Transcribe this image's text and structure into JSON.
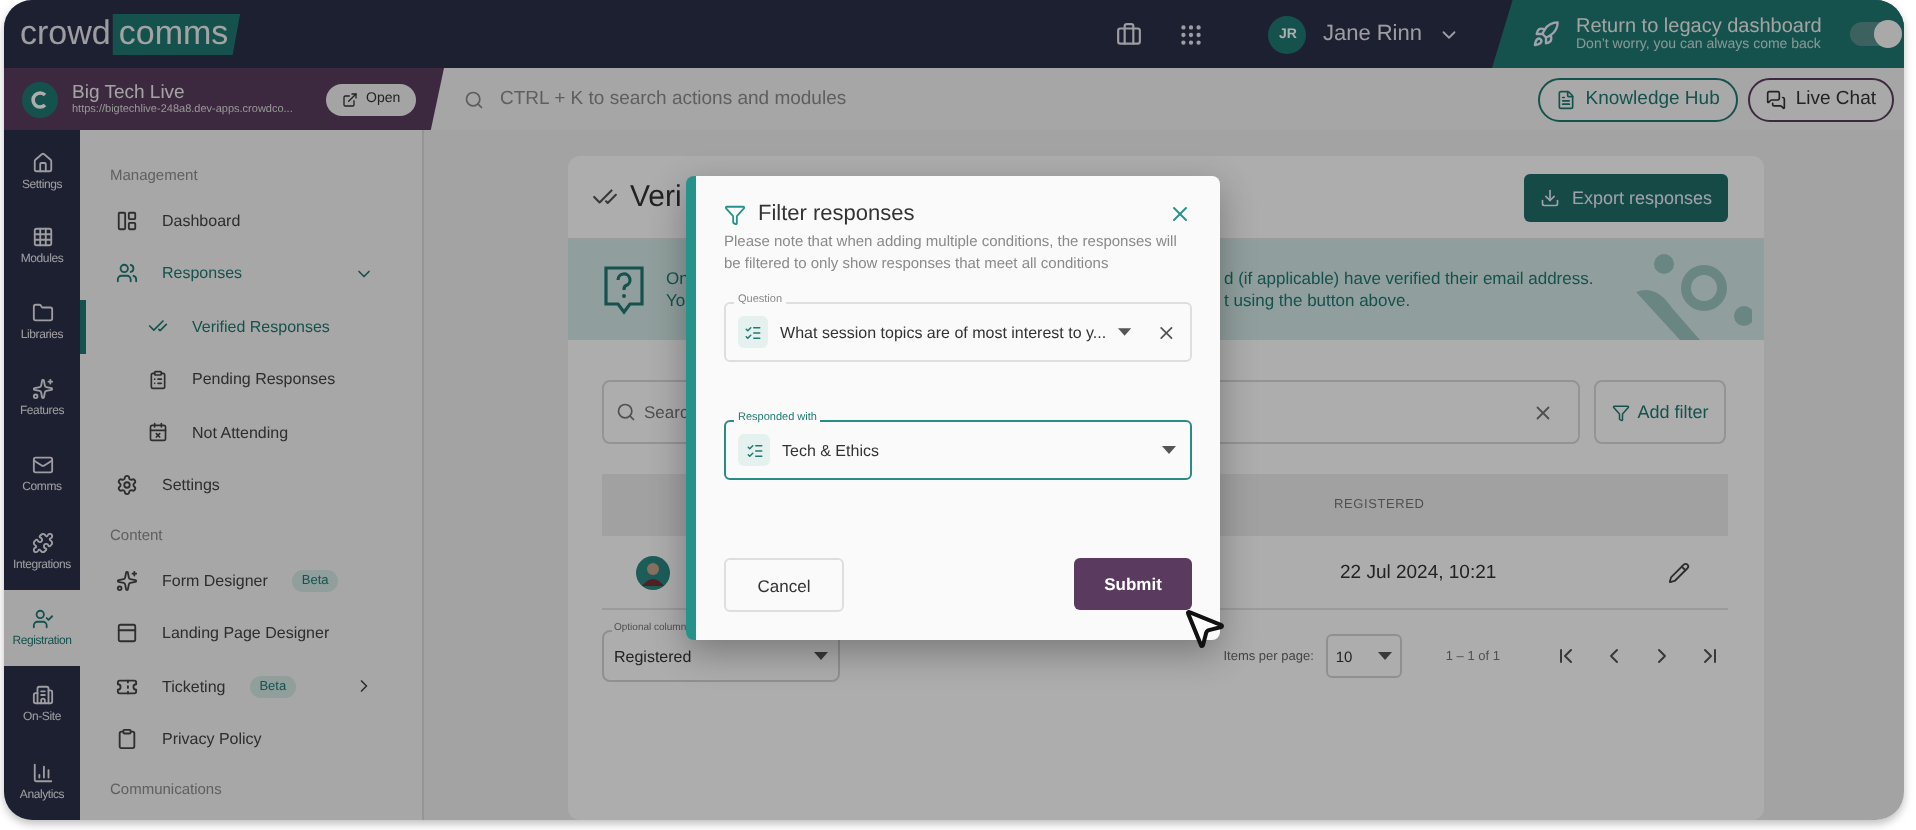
{
  "top_bar": {
    "logo": {
      "part_1": "crowd",
      "part_2": "comms"
    },
    "user": {
      "initials": "JR",
      "name": "Jane Rinn"
    },
    "legacy": {
      "title": "Return to legacy dashboard",
      "subtitle": "Don’t worry, you can always come back",
      "on": true
    }
  },
  "project": {
    "name": "Big Tech Live",
    "url": "https://bigtechlive-248a8.dev-apps.crowdco...",
    "open_button": "Open"
  },
  "search": {
    "placeholder": "CTRL + K to search actions and modules"
  },
  "help_buttons": [
    "Knowledge Hub",
    "Live Chat"
  ],
  "rail": [
    {
      "label": "Settings",
      "selected": false
    },
    {
      "label": "Modules",
      "selected": false
    },
    {
      "label": "Libraries",
      "selected": false
    },
    {
      "label": "Features",
      "selected": false
    },
    {
      "label": "Comms",
      "selected": false
    },
    {
      "label": "Integrations",
      "selected": false
    },
    {
      "label": "Registration",
      "selected": true
    },
    {
      "label": "On-Site",
      "selected": false
    },
    {
      "label": "Analytics",
      "selected": false
    }
  ],
  "nav": [
    {
      "title": "Management",
      "items": [
        {
          "label": "Dashboard",
          "selected": false
        },
        {
          "label": "Responses",
          "selected": false,
          "expanded": true,
          "children": [
            {
              "label": "Verified Responses",
              "selected": true
            },
            {
              "label": "Pending Responses",
              "selected": false
            },
            {
              "label": "Not Attending",
              "selected": false
            }
          ]
        },
        {
          "label": "Settings",
          "selected": false
        }
      ]
    },
    {
      "title": "Content",
      "items": [
        {
          "label": "Form Designer",
          "selected": false,
          "badge": "Beta"
        },
        {
          "label": "Landing Page Designer",
          "selected": false
        },
        {
          "label": "Ticketing",
          "selected": false,
          "badge": "Beta",
          "expanded": false
        },
        {
          "label": "Privacy Policy",
          "selected": false
        }
      ]
    },
    {
      "title": "Communications"
    }
  ],
  "page": {
    "title": "Veri",
    "export_button": "Export responses",
    "info": {
      "left_lines": [
        "On",
        "Yo"
      ],
      "right_lines": [
        "d (if applicable) have verified their email address.",
        "t using the button above."
      ]
    },
    "search_placeholder": "Searc",
    "add_filter": "Add filter",
    "table": {
      "columns": [
        "REGISTERED"
      ],
      "rows": [
        {
          "registered": "22 Jul 2024, 10:21"
        }
      ]
    },
    "optional_column": {
      "label": "Optional column",
      "value": "Registered"
    },
    "pagination": {
      "items_per_page_label": "Items per page:",
      "items_per_page": "10",
      "range": "1 – 1 of 1"
    }
  },
  "modal": {
    "title": "Filter responses",
    "description": "Please note that when adding multiple conditions, the responses will be filtered to only show responses that meet all conditions",
    "fields": [
      {
        "label": "Question",
        "value": "What session topics are of most interest to y...",
        "focused": false,
        "clearable": true
      },
      {
        "label": "Responded with",
        "value": "Tech & Ethics",
        "focused": true,
        "clearable": false
      }
    ],
    "buttons": {
      "cancel": "Cancel",
      "submit": "Submit"
    }
  }
}
